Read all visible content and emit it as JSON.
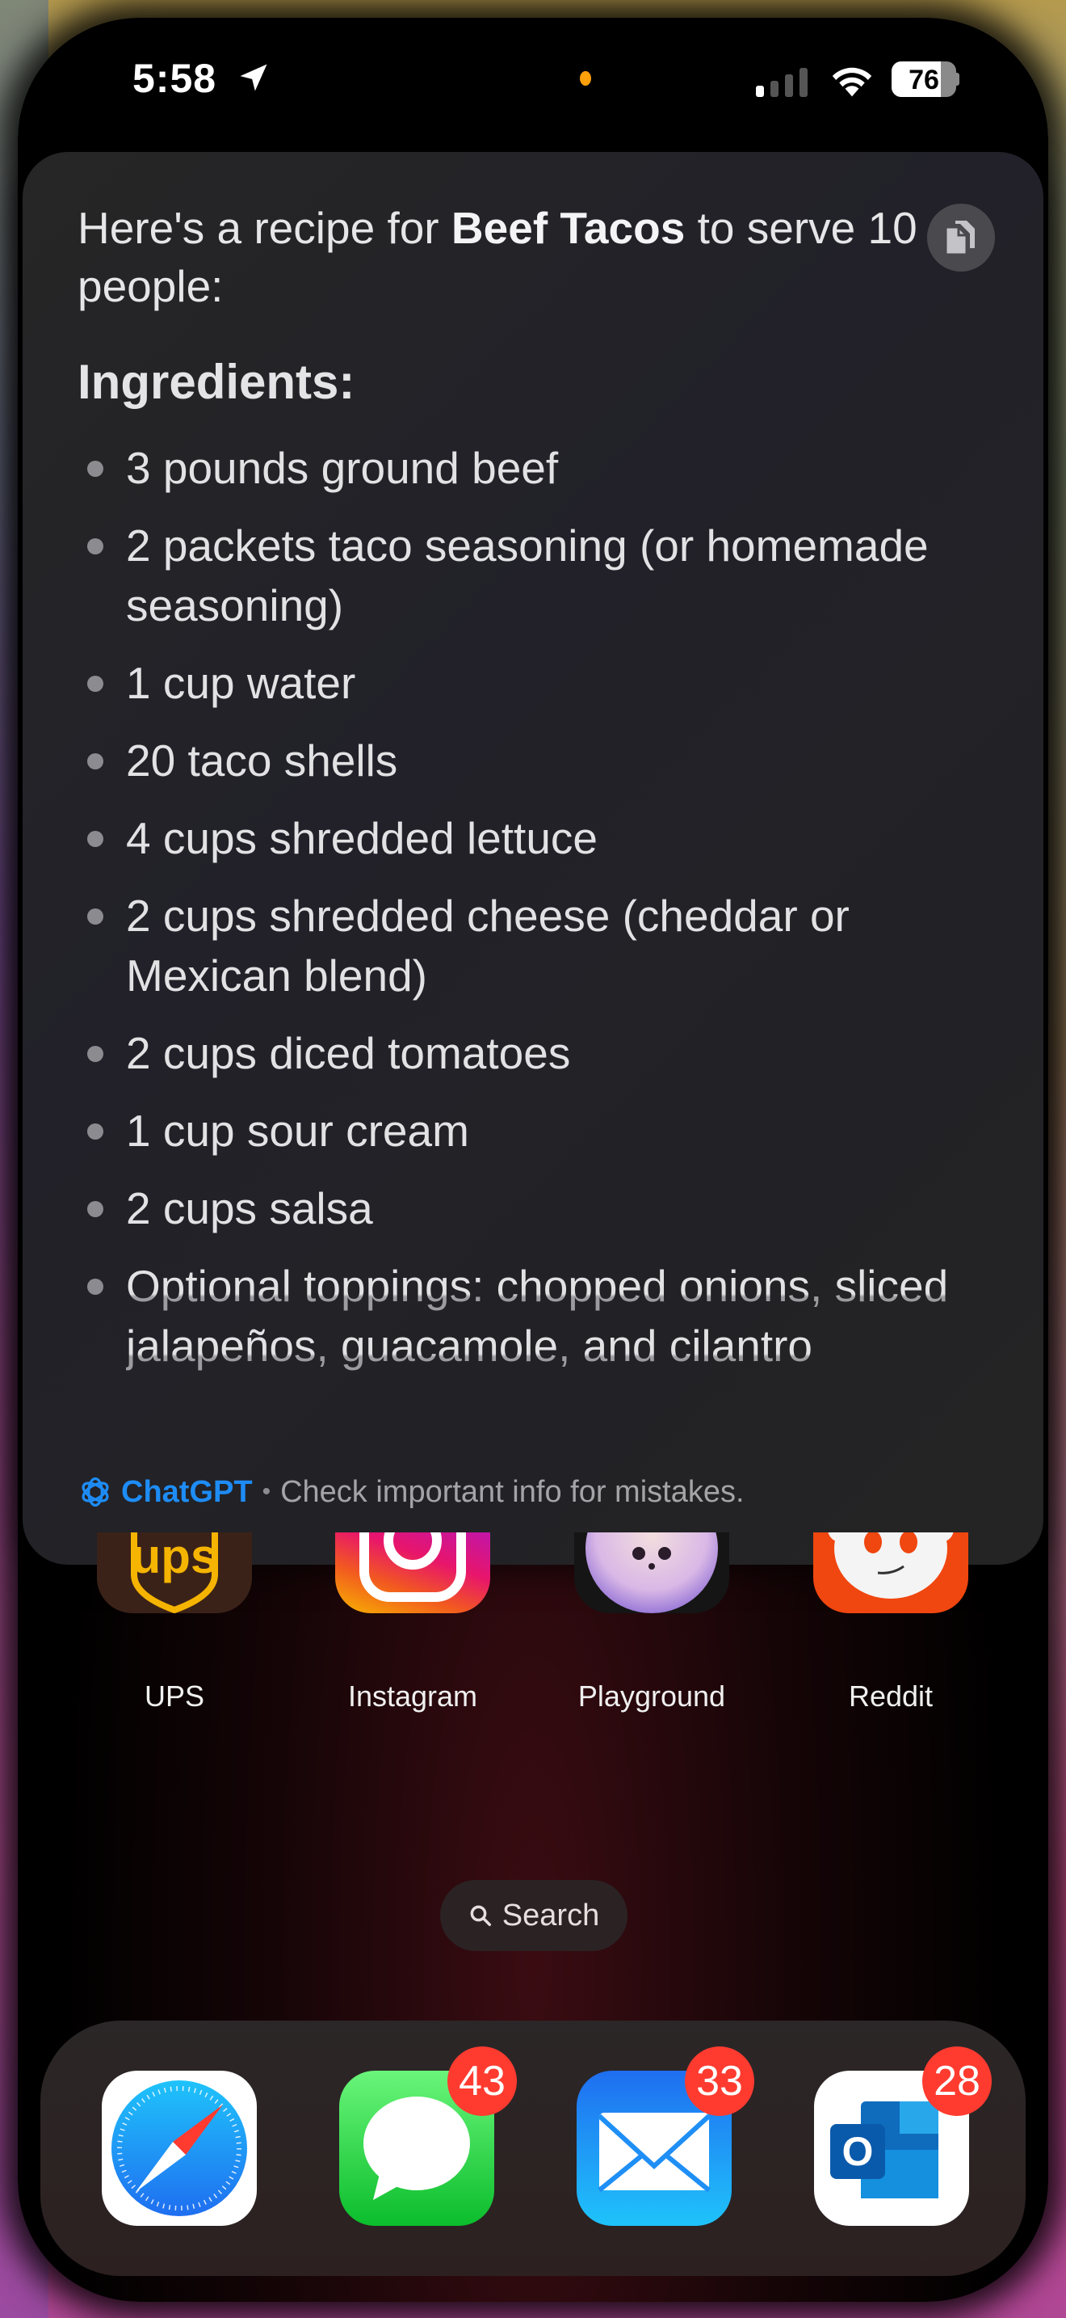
{
  "status_bar": {
    "time": "5:58",
    "location_icon": "location-arrow-icon",
    "signal_bars_active": 1,
    "signal_bars_total": 4,
    "wifi_icon": "wifi-icon",
    "battery_percent": 76
  },
  "response_card": {
    "intro_prefix": "Here's a recipe for ",
    "intro_bold": "Beef Tacos",
    "intro_suffix": " to serve 10 people:",
    "copy_icon": "copy-icon",
    "heading": "Ingredients:",
    "ingredients": [
      "3 pounds ground beef",
      "2 packets taco seasoning (or homemade seasoning)",
      "1 cup water",
      "20 taco shells",
      "4 cups shredded lettuce",
      "2 cups shredded cheese (cheddar or Mexican blend)",
      "2 cups diced tomatoes",
      "1 cup sour cream",
      "2 cups salsa",
      "Optional toppings: chopped onions, sliced jalapeños, guacamole, and cilantro"
    ],
    "footer": {
      "brand": "ChatGPT",
      "separator": "•",
      "note": "Check important info for mistakes.",
      "brand_color": "#1e8cf5"
    }
  },
  "home_apps": [
    {
      "label": "UPS",
      "icon": "ups-icon"
    },
    {
      "label": "Instagram",
      "icon": "instagram-icon"
    },
    {
      "label": "Playground",
      "icon": "playground-icon"
    },
    {
      "label": "Reddit",
      "icon": "reddit-icon"
    }
  ],
  "search": {
    "label": "Search"
  },
  "dock": [
    {
      "name": "Safari",
      "icon": "safari-icon",
      "badge": null
    },
    {
      "name": "Messages",
      "icon": "messages-icon",
      "badge": "43"
    },
    {
      "name": "Mail",
      "icon": "mail-icon",
      "badge": "33"
    },
    {
      "name": "Outlook",
      "icon": "outlook-icon",
      "badge": "28"
    }
  ],
  "colors": {
    "badge": "#ff3b30",
    "camera_indicator": "#ff9f0a"
  }
}
